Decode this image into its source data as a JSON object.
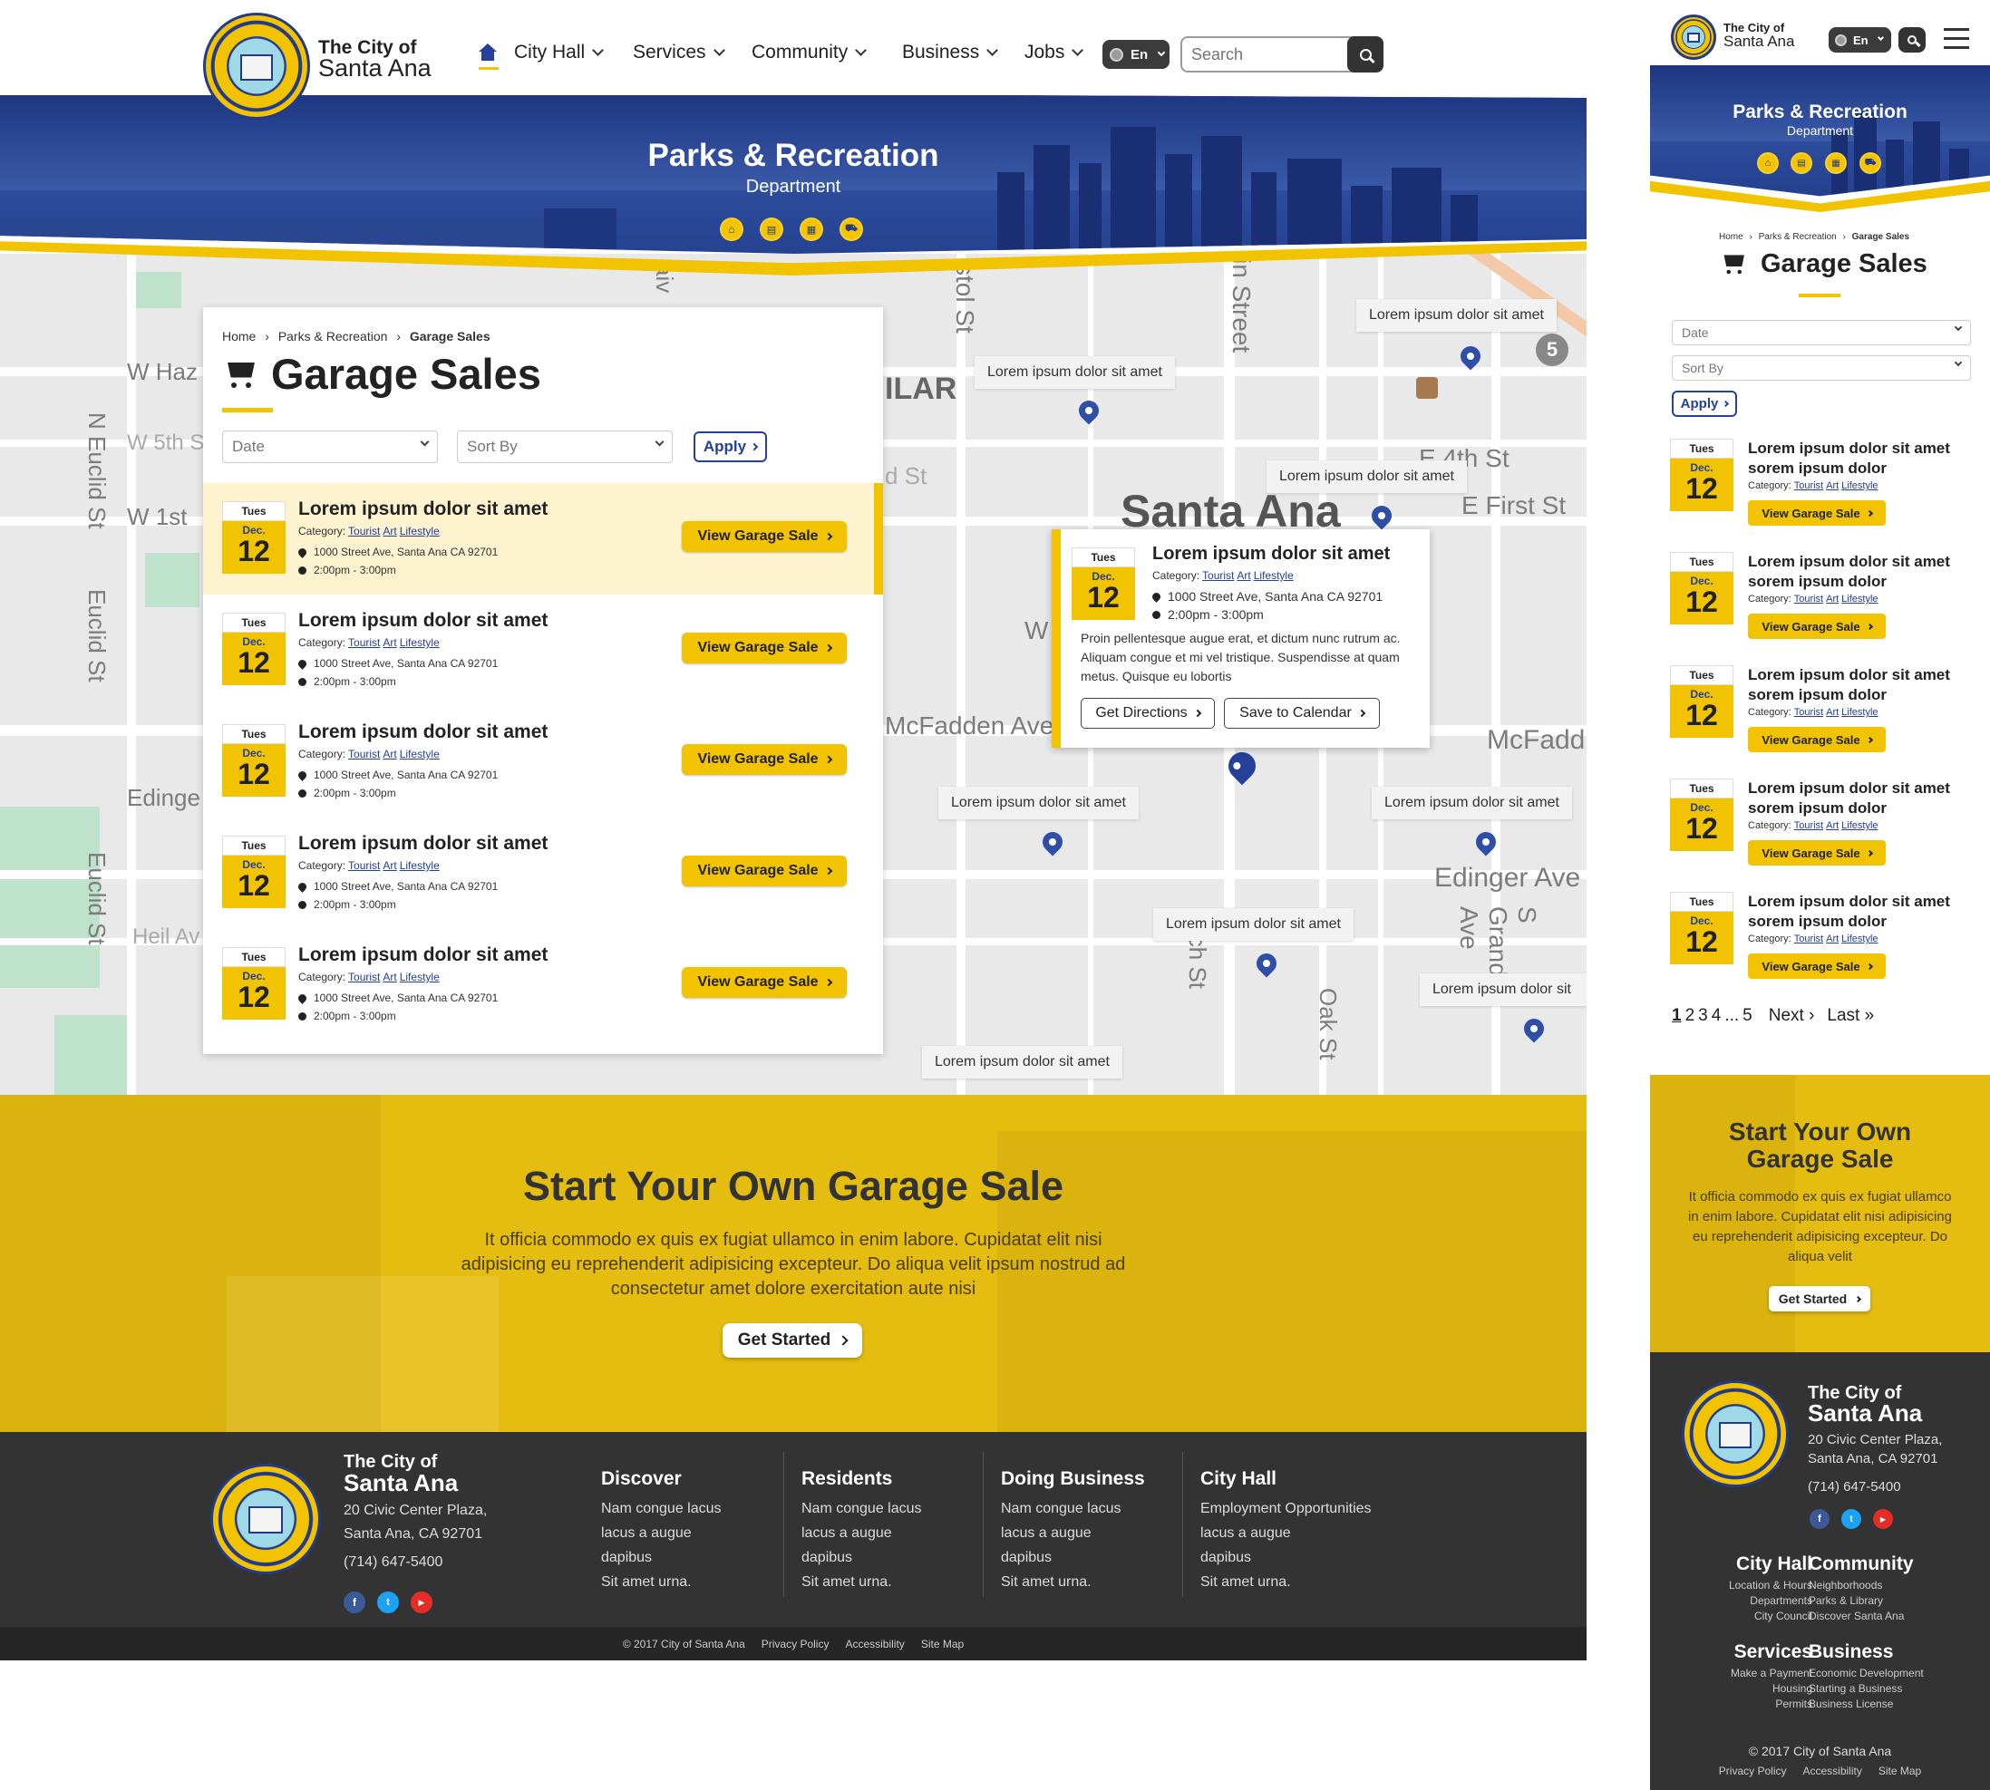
{
  "site": {
    "logo_line1": "The City of",
    "logo_line2": "Santa Ana"
  },
  "nav": {
    "items": [
      "City Hall",
      "Services",
      "Community",
      "Business",
      "Jobs"
    ],
    "lang": "En",
    "search_placeholder": "Search"
  },
  "hero": {
    "title": "Parks & Recreation",
    "subtitle": "Department",
    "icons": [
      "home-icon",
      "card-icon",
      "calendar-icon",
      "cart-icon"
    ]
  },
  "breadcrumb": {
    "home": "Home",
    "section": "Parks & Recreation",
    "current": "Garage Sales"
  },
  "page": {
    "title": "Garage Sales"
  },
  "filters": {
    "date": "Date",
    "sort": "Sort By",
    "apply": "Apply"
  },
  "event": {
    "day": "Tues",
    "month": "Dec.",
    "date": "12",
    "title": "Lorem ipsum dolor sit amet",
    "category_label": "Category:",
    "categories": [
      "Tourist",
      "Art",
      "Lifestyle"
    ],
    "address": "1000 Street Ave, Santa Ana CA 92701",
    "time": "2:00pm - 3:00pm",
    "view": "View Garage Sale"
  },
  "map": {
    "tooltip": "Lorem ipsum dolor sit amet",
    "tooltip_cut": "Lorem ipsum dolor sit",
    "streets": [
      "W Haz",
      "W 5th S",
      "W 1st",
      "N Euclid St",
      "Euclid St",
      "Edinge",
      "Euclid St",
      "Heil Av",
      "ILAR",
      "d St",
      "McFadden Ave",
      "W",
      "Santa Ana",
      "E 4th St",
      "E First St",
      "McFadd",
      "Edinger Ave",
      "S Grand Ave",
      "Oak St",
      "Birch St",
      "stol St",
      "in Street",
      "aiv",
      "5"
    ],
    "popup": {
      "text": "Proin pellentesque augue erat, et dictum nunc rutrum ac. Aliquam congue et mi vel tristique. Suspendisse at quam metus. Quisque eu lobortis",
      "directions": "Get Directions",
      "calendar": "Save to Calendar"
    }
  },
  "promo": {
    "title": "Start Your Own Garage Sale",
    "mobile_title_1": "Start Your Own",
    "mobile_title_2": "Garage Sale",
    "text": "It officia commodo ex quis ex fugiat ullamco in enim labore. Cupidatat elit nisi adipisicing eu reprehenderit adipisicing excepteur. Do aliqua velit ipsum nostrud ad consectetur amet dolore exercitation aute nisi",
    "mobile_text": "It officia commodo ex quis ex fugiat ullamco in enim labore. Cupidatat elit nisi adipisicing eu reprehenderit adipisicing excepteur. Do aliqua velit",
    "button": "Get Started"
  },
  "footer": {
    "addr1": "20 Civic Center Plaza,",
    "addr2": "Santa Ana, CA 92701",
    "addr_mobile": "20 Civic Center Plaza,",
    "phone": "(714) 647-5400",
    "columns": [
      {
        "title": "Discover",
        "links": [
          "Nam congue lacus",
          "lacus a augue",
          "dapibus",
          "Sit amet urna."
        ]
      },
      {
        "title": "Residents",
        "links": [
          "Nam congue lacus",
          "lacus a augue",
          "dapibus",
          "Sit amet urna."
        ]
      },
      {
        "title": "Doing Business",
        "links": [
          "Nam congue lacus",
          "lacus a augue",
          "dapibus",
          "Sit amet urna."
        ]
      },
      {
        "title": "City Hall",
        "links": [
          "Employment Opportunities",
          "lacus a augue",
          "dapibus",
          "Sit amet urna."
        ]
      }
    ],
    "copyright": "© 2017 City of Santa Ana",
    "privacy": "Privacy Policy",
    "accessibility": "Accessibility",
    "sitemap": "Site Map"
  },
  "mobile": {
    "event_title": "Lorem ipsum dolor sit amet sorem ipsum dolor",
    "pagination": [
      "1",
      "2",
      "3",
      "4",
      "...",
      "5"
    ],
    "next": "Next",
    "last": "Last",
    "footer_groups": [
      {
        "title": "City Hall",
        "links": [
          "Location & Hours",
          "Departments",
          "City Council"
        ]
      },
      {
        "title": "Community",
        "links": [
          "Neighborhoods",
          "Parks & Library",
          "Discover Santa Ana"
        ]
      },
      {
        "title": "Services",
        "links": [
          "Make a Payment",
          "Housing",
          "Permits"
        ]
      },
      {
        "title": "Business",
        "links": [
          "Economic Development",
          "Starting a Business",
          "Business License"
        ]
      }
    ]
  },
  "colors": {
    "brand_blue": "#24409a",
    "brand_yellow": "#f2c300",
    "footer_dark": "#333333"
  }
}
